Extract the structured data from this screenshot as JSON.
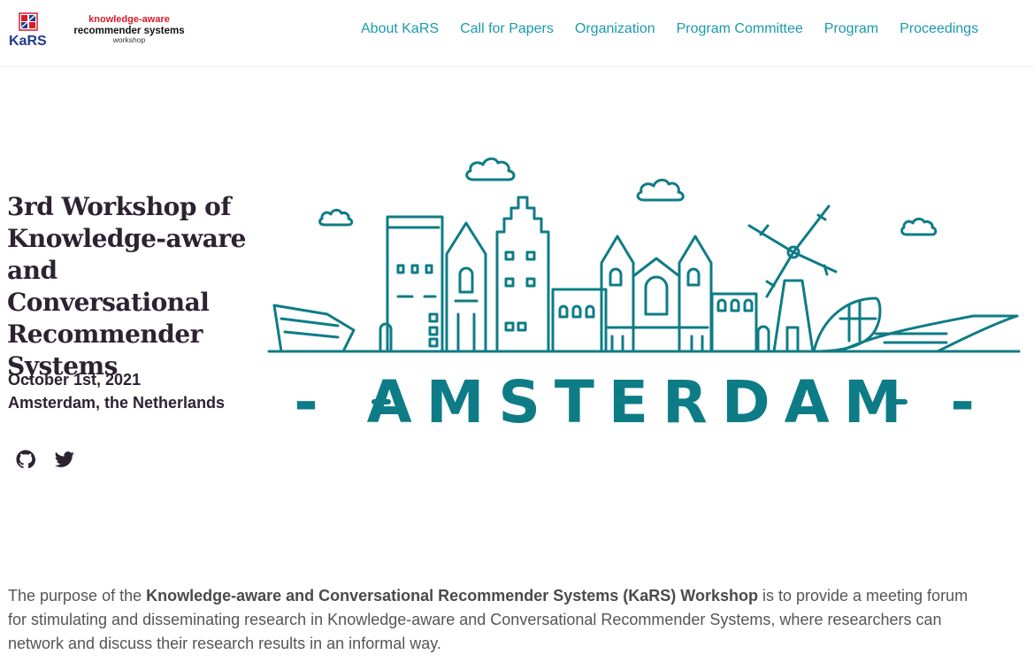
{
  "logo": {
    "mark_text": "KaRS",
    "line1": "knowledge-aware",
    "line2": "recommender systems",
    "line3": "workshop"
  },
  "nav": {
    "items": [
      {
        "label": "About KaRS"
      },
      {
        "label": "Call for Papers"
      },
      {
        "label": "Organization"
      },
      {
        "label": "Program Committee"
      },
      {
        "label": "Program"
      },
      {
        "label": "Proceedings"
      }
    ]
  },
  "hero": {
    "title": "3rd Workshop of Knowledge-aware and Conversational Recommender Systems",
    "date": "October 1st, 2021",
    "location": "Amsterdam, the Netherlands",
    "socials": [
      "github-icon",
      "twitter-icon"
    ],
    "illustration_caption": "- AMSTERDAM -"
  },
  "intro": {
    "prefix": "The purpose of the ",
    "bold": "Knowledge-aware and Conversational Recommender Systems (KaRS) Workshop",
    "suffix": " is to provide a meeting forum for stimulating and disseminating research in Knowledge-aware and Conversational Recommender Systems, where researchers can network and discuss their research results in an informal way."
  },
  "colors": {
    "nav_link": "#1b9aaa",
    "title": "#2d2232",
    "body_text": "#555555",
    "illustration": "#0e7c86",
    "logo_red": "#d61c2b",
    "logo_blue": "#1f3a8f"
  }
}
